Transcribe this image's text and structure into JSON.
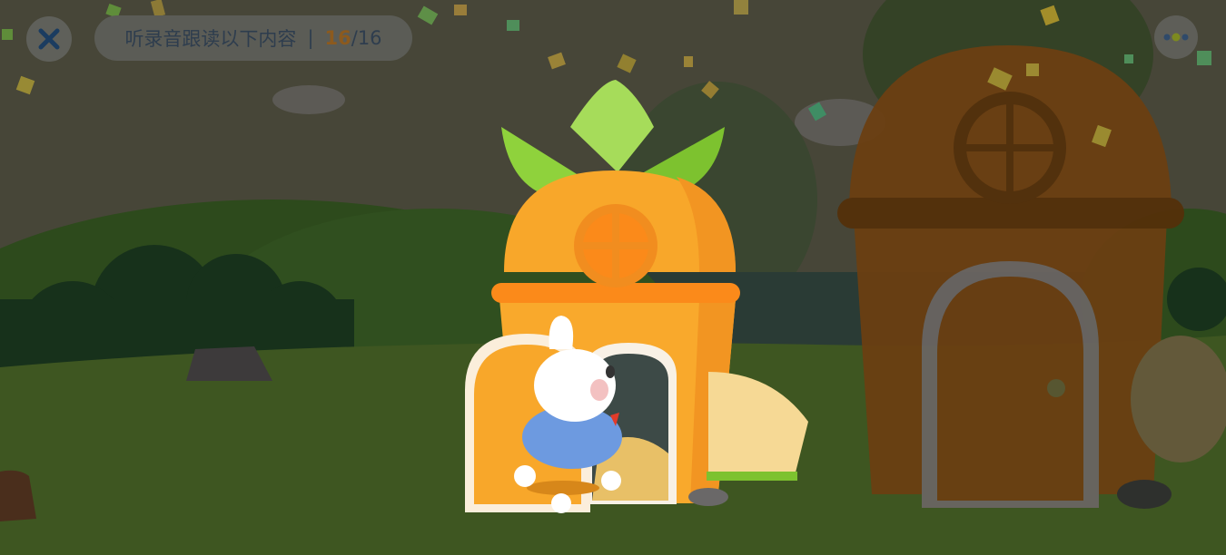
{
  "instruction": {
    "text": "听录音跟读以下内容",
    "separator": "|",
    "current": "16",
    "total": "/16"
  },
  "progress": {
    "current": 16,
    "total": 16
  },
  "icons": {
    "close": "close-icon",
    "menu": "menu-dots-icon"
  },
  "colors": {
    "sky_dim": "#474638",
    "grass": "#3e5621",
    "carrot_orange": "#f8a72a",
    "leaf_green": "#8fd23c",
    "dim_overlay": "rgba(0,0,0,0.55)"
  }
}
